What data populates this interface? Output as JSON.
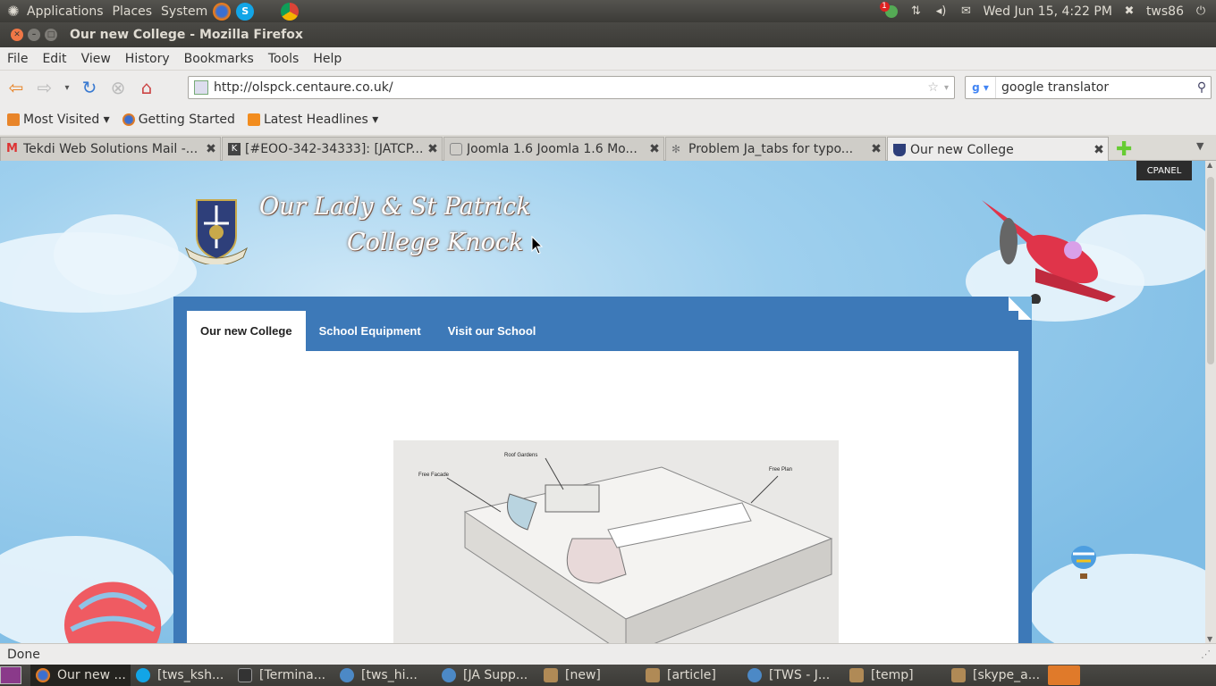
{
  "top_panel": {
    "menus": [
      "Applications",
      "Places",
      "System"
    ],
    "notification_count": "1",
    "datetime": "Wed Jun 15,  4:22 PM",
    "user": "tws86"
  },
  "window": {
    "title": "Our new College - Mozilla Firefox"
  },
  "menu_bar": [
    "File",
    "Edit",
    "View",
    "History",
    "Bookmarks",
    "Tools",
    "Help"
  ],
  "nav": {
    "url": "http://olspck.centaure.co.uk/",
    "search_query": "google translator"
  },
  "bookmarks": [
    {
      "label": "Most Visited ▾"
    },
    {
      "label": "Getting Started"
    },
    {
      "label": "Latest Headlines ▾"
    }
  ],
  "tabs": [
    {
      "label": "Tekdi Web Solutions Mail -..."
    },
    {
      "label": "[#EOO-342-34333]: [JATCP..."
    },
    {
      "label": "Joomla 1.6 Joomla 1.6 Mo..."
    },
    {
      "label": "Problem Ja_tabs for typo..."
    },
    {
      "label": "Our new College"
    }
  ],
  "page": {
    "cpanel": "CPANEL",
    "title_line1": "Our Lady & St Patrick",
    "title_line2": "College Knock",
    "crest_motto": "VERITAS AGAMUS",
    "nav_tabs": [
      "Our new College",
      "School Equipment",
      "Visit our School"
    ],
    "diagram_labels": [
      "Roof Gardens",
      "Free Facade",
      "Free Plan"
    ]
  },
  "status": {
    "text": "Done"
  },
  "taskbar": [
    {
      "label": "Our new ..."
    },
    {
      "label": "[tws_ksh..."
    },
    {
      "label": "[Termina..."
    },
    {
      "label": "[tws_hi..."
    },
    {
      "label": "[JA Supp..."
    },
    {
      "label": "[new]"
    },
    {
      "label": "[article]"
    },
    {
      "label": "[TWS - J..."
    },
    {
      "label": "[temp]"
    },
    {
      "label": "[skype_a..."
    }
  ]
}
